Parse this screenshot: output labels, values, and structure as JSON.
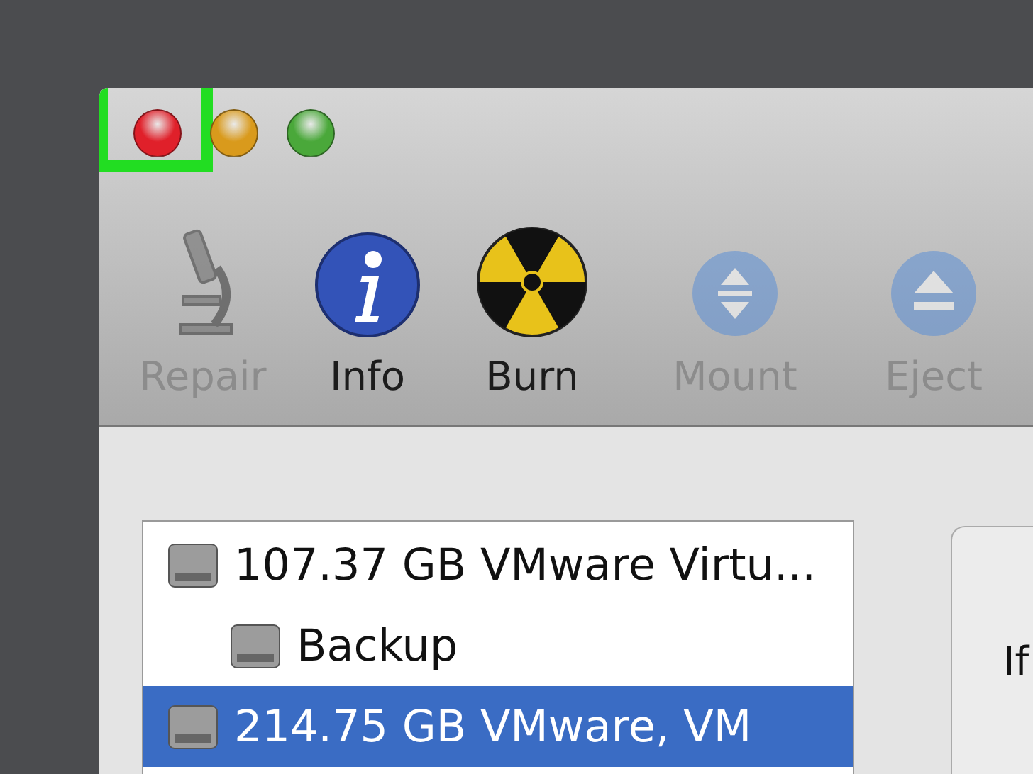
{
  "window": {
    "lights": [
      {
        "kind": "close",
        "highlighted": true
      },
      {
        "kind": "minimize",
        "highlighted": false
      },
      {
        "kind": "zoom",
        "highlighted": false
      }
    ]
  },
  "toolbar": [
    {
      "kind": "microscope",
      "label": "Repair",
      "disabled": true
    },
    {
      "kind": "info",
      "label": "Info",
      "disabled": false
    },
    {
      "kind": "burn",
      "label": "Burn",
      "disabled": false
    },
    {
      "kind": "mount",
      "label": "Mount",
      "disabled": true
    },
    {
      "kind": "eject",
      "label": "Eject",
      "disabled": true
    }
  ],
  "disks": [
    {
      "label": "107.37 GB VMware Virtu...",
      "selected": false,
      "children": [
        {
          "label": "Backup",
          "selected": false
        }
      ]
    },
    {
      "label": "214.75 GB VMware, VM",
      "selected": true
    }
  ],
  "side_panel": {
    "text": "If"
  }
}
